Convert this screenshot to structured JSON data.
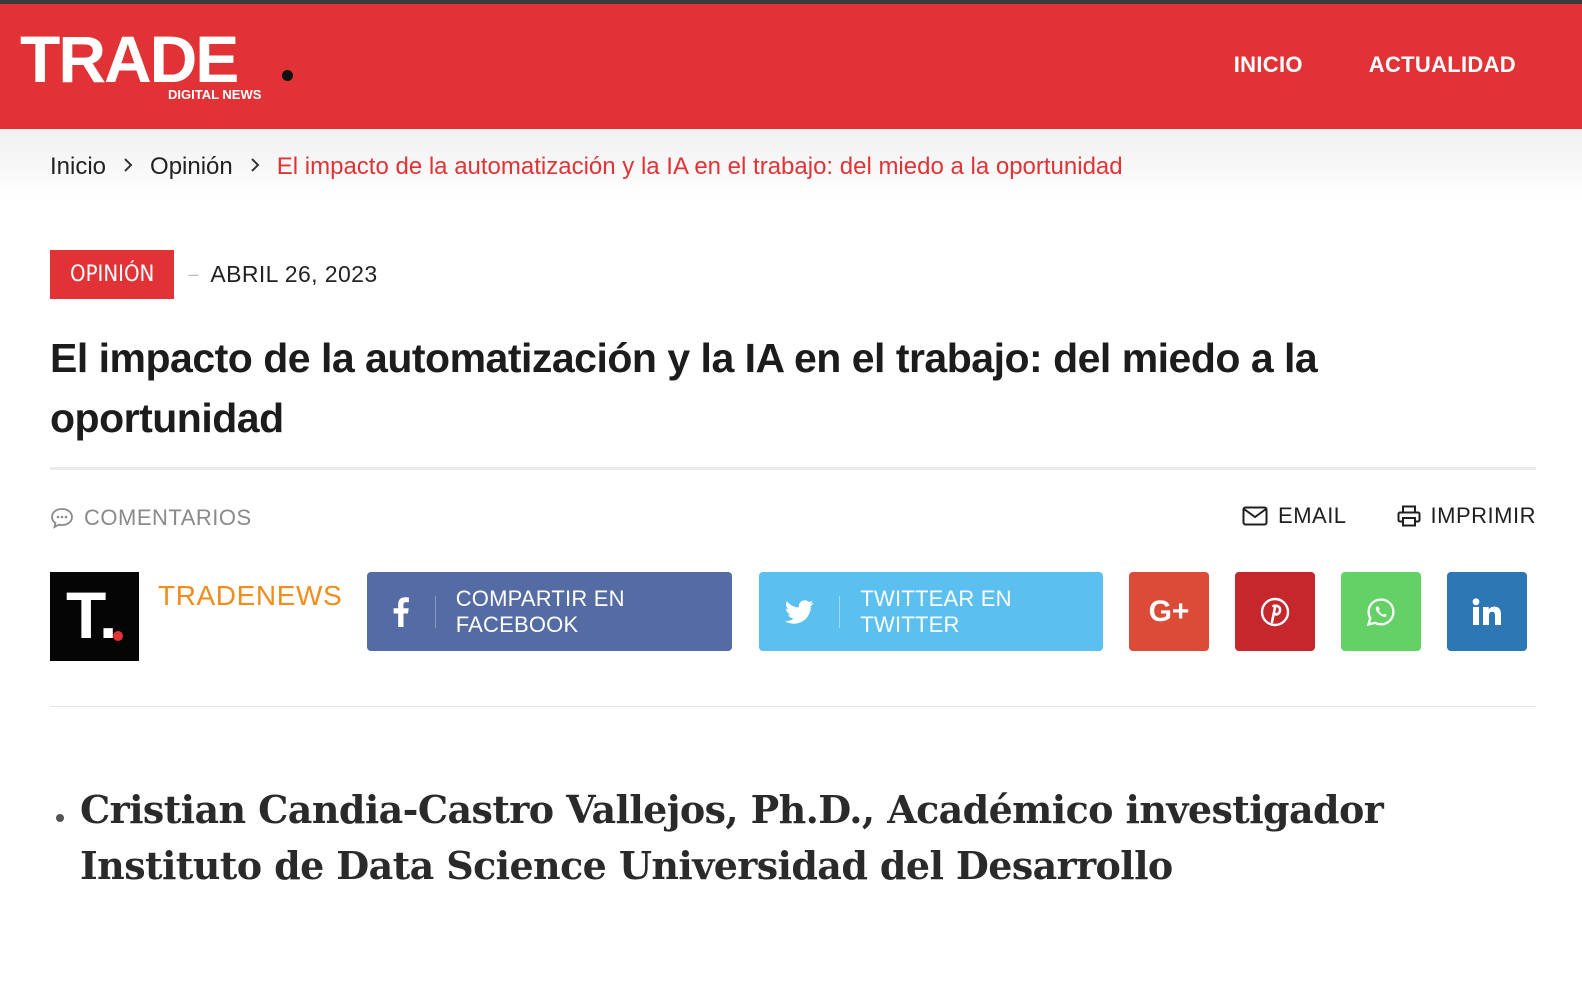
{
  "site": {
    "logo_main": "TRADE",
    "logo_sub": "DIGITAL NEWS"
  },
  "nav": {
    "items": [
      {
        "label": "INICIO"
      },
      {
        "label": "ACTUALIDAD"
      }
    ]
  },
  "breadcrumb": {
    "items": [
      "Inicio",
      "Opinión"
    ],
    "current": "El impacto de la automatización y la IA en el trabajo: del miedo a la oportunidad"
  },
  "article": {
    "category": "OPINIÓN",
    "date": "ABRIL 26, 2023",
    "title": "El impacto de la automatización y la IA en el trabajo: del miedo a la oportunidad",
    "comments_label": "COMENTARIOS",
    "email_label": "EMAIL",
    "print_label": "IMPRIMIR",
    "author": "TRADENEWS",
    "author_initial": "T.",
    "bullet_text": "Cristian Candia-Castro Vallejos, Ph.D., Académico investigador Instituto de Data Science Universidad del Desarrollo"
  },
  "share": {
    "facebook_label": "COMPARTIR EN FACEBOOK",
    "twitter_label": "TWITTEAR EN TWITTER",
    "googleplus_label": "G+",
    "icons": [
      "facebook-icon",
      "twitter-icon",
      "google-plus-icon",
      "pinterest-icon",
      "whatsapp-icon",
      "linkedin-icon"
    ]
  },
  "colors": {
    "brand_red": "#e13336",
    "facebook": "#546ba4",
    "twitter": "#5bc0ef",
    "googleplus": "#dc4a38",
    "pinterest": "#c5272d",
    "whatsapp": "#64d166",
    "linkedin": "#2c77b4",
    "author_orange": "#f28c1b"
  }
}
